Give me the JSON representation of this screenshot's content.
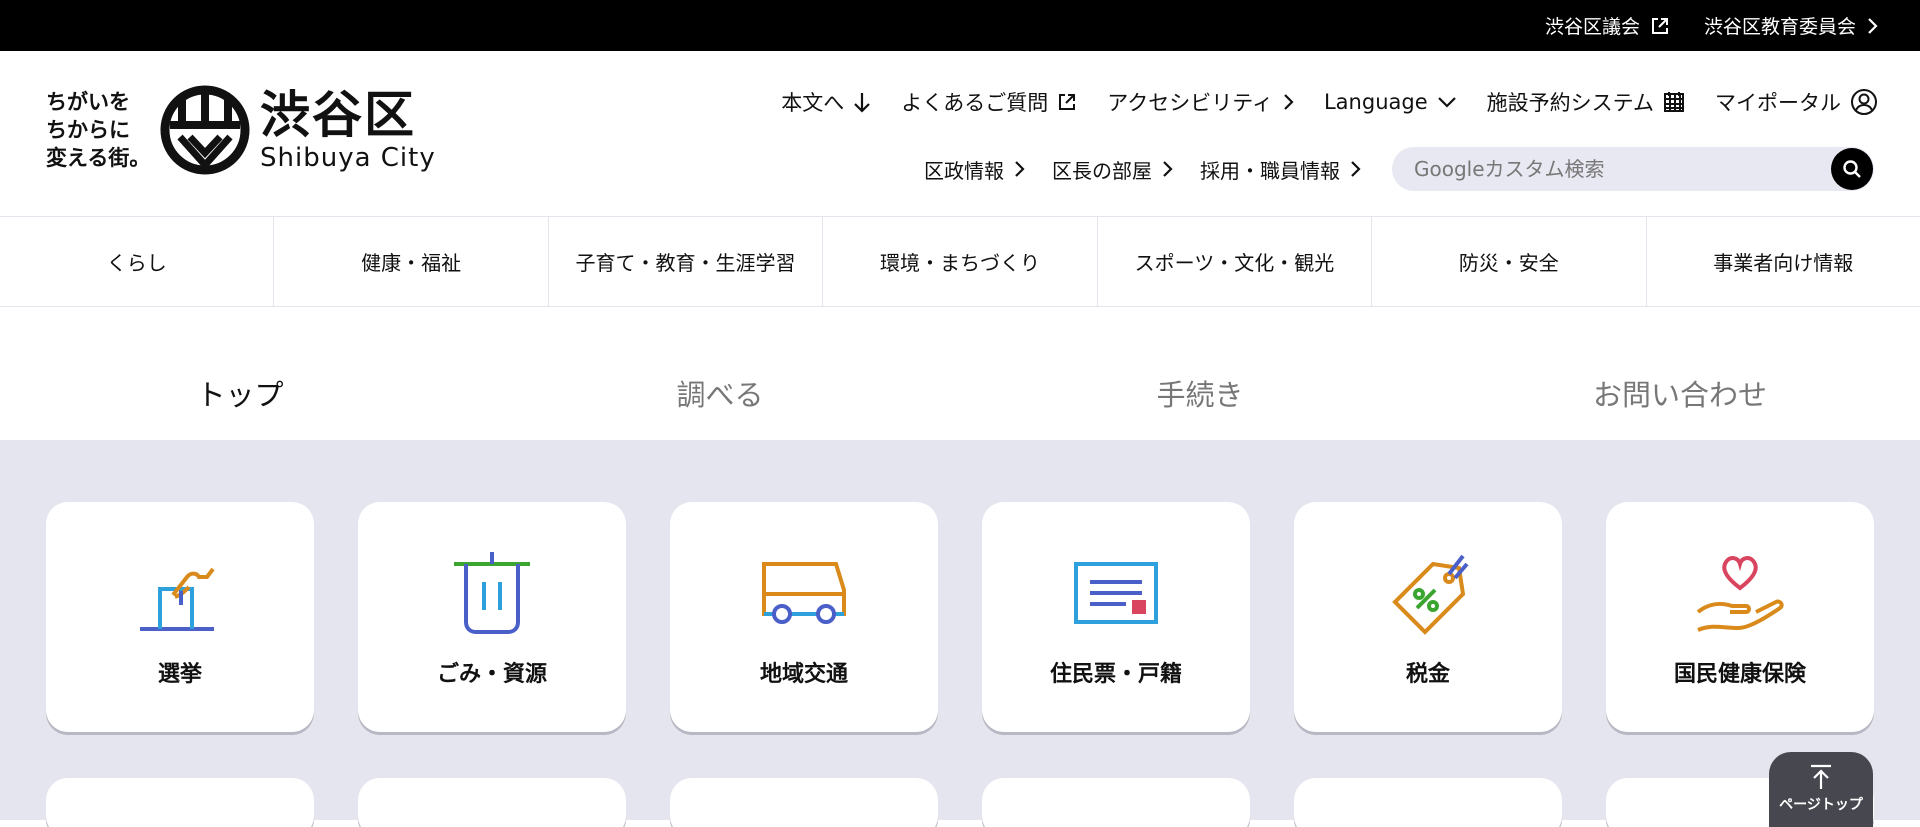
{
  "topbar": {
    "links": [
      {
        "label": "渋谷区議会",
        "icon": "external-link-icon"
      },
      {
        "label": "渋谷区教育委員会",
        "icon": "chevron-right-icon"
      }
    ]
  },
  "logo": {
    "catch_line1": "ちがいを",
    "catch_line2": "ちからに",
    "catch_line3": "変える街。",
    "name_jp": "渋谷区",
    "name_en": "Shibuya City"
  },
  "util_nav": [
    {
      "label": "本文へ",
      "icon": "arrow-down-icon"
    },
    {
      "label": "よくあるご質問",
      "icon": "external-link-icon"
    },
    {
      "label": "アクセシビリティ",
      "icon": "chevron-right-icon"
    },
    {
      "label": "Language",
      "icon": "chevron-down-icon"
    },
    {
      "label": "施設予約システム",
      "icon": "calendar-icon"
    },
    {
      "label": "マイポータル",
      "icon": "user-icon"
    }
  ],
  "sub_nav": [
    {
      "label": "区政情報",
      "icon": "chevron-right-icon"
    },
    {
      "label": "区長の部屋",
      "icon": "chevron-right-icon"
    },
    {
      "label": "採用・職員情報",
      "icon": "chevron-right-icon"
    }
  ],
  "search": {
    "placeholder": "Googleカスタム検索",
    "value": ""
  },
  "global_nav": [
    "くらし",
    "健康・福祉",
    "子育て・教育・生涯学習",
    "環境・まちづくり",
    "スポーツ・文化・観光",
    "防災・安全",
    "事業者向け情報"
  ],
  "tabs": [
    {
      "label": "トップ",
      "active": true
    },
    {
      "label": "調べる",
      "active": false
    },
    {
      "label": "手続き",
      "active": false
    },
    {
      "label": "お問い合わせ",
      "active": false
    }
  ],
  "cards": [
    {
      "label": "選挙",
      "icon": "ballot-box-icon"
    },
    {
      "label": "ごみ・資源",
      "icon": "trash-bin-icon"
    },
    {
      "label": "地域交通",
      "icon": "bus-icon"
    },
    {
      "label": "住民票・戸籍",
      "icon": "certificate-icon"
    },
    {
      "label": "税金",
      "icon": "tax-tag-icon"
    },
    {
      "label": "国民健康保険",
      "icon": "heart-hand-icon"
    }
  ],
  "page_top": {
    "label": "ページトップ"
  },
  "colors": {
    "topbar": "#000000",
    "card_area": "#e5e5ef",
    "orange": "#d98a1a",
    "blue": "#4a5fc8",
    "green": "#3aa52f",
    "red": "#d9455f",
    "cyan": "#2ea0dc"
  }
}
